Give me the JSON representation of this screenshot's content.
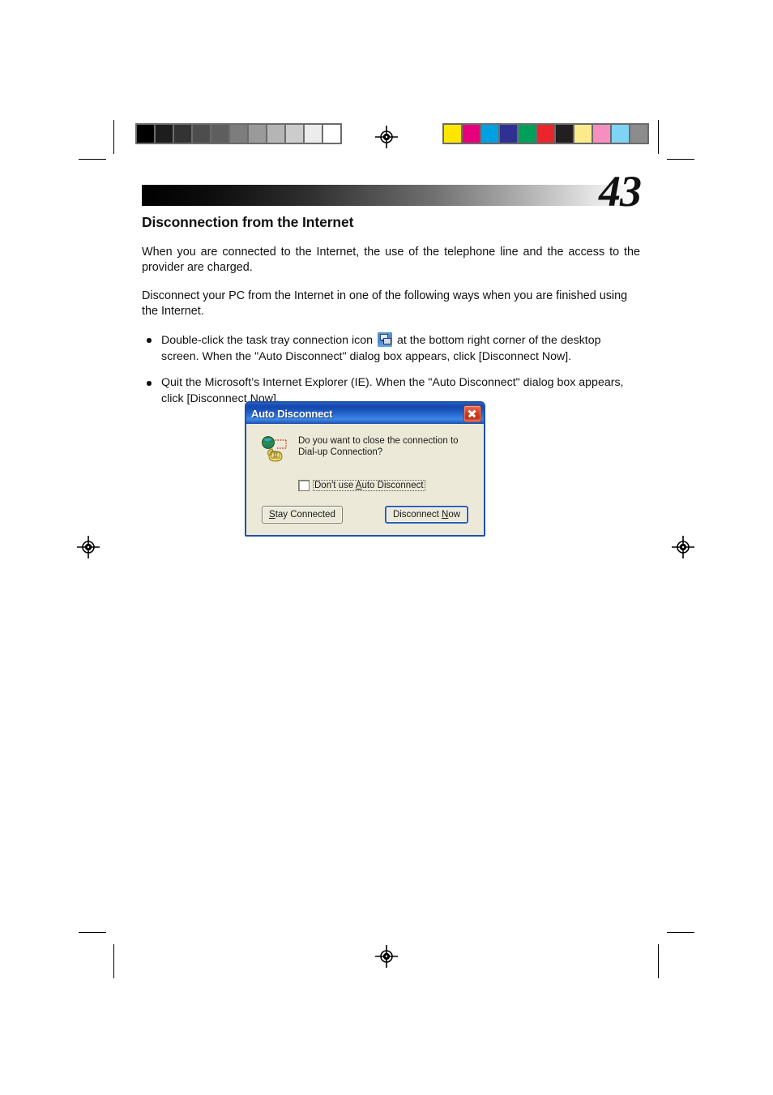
{
  "page": {
    "number": "43",
    "section_title": "Disconnection from the Internet",
    "paragraphs": [
      "When you are connected to the Internet, the use of the telephone line and the access to the provider are charged.",
      "Disconnect your PC from the Internet in one of the following ways when you are finished using the Internet."
    ],
    "bullets": [
      {
        "text_before_icon": "Double-click the task tray connection icon",
        "icon": "network-connection-tray-icon",
        "text_after_icon": "at the bottom right corner of the desktop screen.  When the \"Auto Disconnect\" dialog box appears, click [Disconnect Now]."
      },
      {
        "text": "Quit the Microsoft’s Internet Explorer (IE).  When the \"Auto Disconnect\" dialog box appears, click [Disconnect Now]."
      }
    ]
  },
  "print_marks": {
    "grayscale_patches": [
      "#000000",
      "#1d1d1d",
      "#333333",
      "#4d4d4d",
      "#5e5e5e",
      "#7d7d7d",
      "#9a9a9a",
      "#b5b5b5",
      "#cccccc",
      "#ececec",
      "#ffffff"
    ],
    "color_patches": [
      "#ffe600",
      "#e6007e",
      "#00a0e3",
      "#2e3192",
      "#00a05a",
      "#e8262b",
      "#231f20",
      "#fbeb8c",
      "#f48fc0",
      "#7fd4f4",
      "#8c8c8c"
    ],
    "registration_icon": "registration-target-icon"
  },
  "dialog": {
    "title": "Auto Disconnect",
    "close_label": "✕",
    "icon": "dialup-connection-icon",
    "message": "Do you want to close the connection to Dial-up Connection?",
    "checkbox": {
      "label_pre": "Don't use ",
      "label_accel": "A",
      "label_post": "uto Disconnect",
      "checked": false
    },
    "buttons": [
      {
        "name": "stay-connected",
        "pre": "",
        "accel": "S",
        "post": "tay Connected",
        "default": false
      },
      {
        "name": "disconnect-now",
        "pre": "Disconnect ",
        "accel": "N",
        "post": "ow",
        "default": true
      }
    ]
  }
}
